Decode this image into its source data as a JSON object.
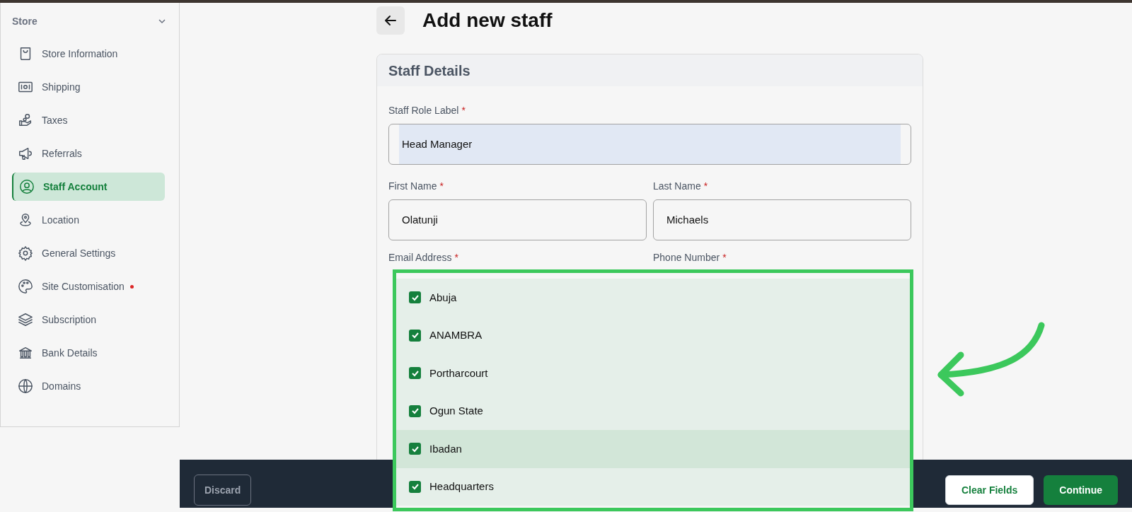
{
  "sidebar": {
    "section": "Store",
    "expanded": true,
    "items": [
      {
        "label": "Store Information",
        "selected": false,
        "notification": false
      },
      {
        "label": "Shipping",
        "selected": false,
        "notification": false
      },
      {
        "label": "Taxes",
        "selected": false,
        "notification": false
      },
      {
        "label": "Referrals",
        "selected": false,
        "notification": false
      },
      {
        "label": "Staff Account",
        "selected": true,
        "notification": false
      },
      {
        "label": "Location",
        "selected": false,
        "notification": false
      },
      {
        "label": "General Settings",
        "selected": false,
        "notification": false
      },
      {
        "label": "Site Customisation",
        "selected": false,
        "notification": true
      },
      {
        "label": "Subscription",
        "selected": false,
        "notification": false
      },
      {
        "label": "Bank Details",
        "selected": false,
        "notification": false
      },
      {
        "label": "Domains",
        "selected": false,
        "notification": false
      }
    ]
  },
  "page": {
    "title": "Add new staff"
  },
  "card": {
    "title": "Staff Details",
    "fields": [
      {
        "label": "Staff Role Label",
        "required_mark": "*",
        "value": "Head Manager",
        "highlighted": true
      },
      {
        "label": "First Name",
        "required_mark": "*",
        "value": "Olatunji",
        "highlighted": false
      },
      {
        "label": "Last Name",
        "required_mark": "*",
        "value": "Michaels",
        "highlighted": false
      },
      {
        "label": "Email Address",
        "required_mark": "*"
      },
      {
        "label": "Phone Number",
        "required_mark": "*"
      }
    ]
  },
  "location_dropdown": {
    "options": [
      {
        "label": "Abuja",
        "checked": true,
        "hovered": false
      },
      {
        "label": "ANAMBRA",
        "checked": true,
        "hovered": false
      },
      {
        "label": "Portharcourt",
        "checked": true,
        "hovered": false
      },
      {
        "label": "Ogun State",
        "checked": true,
        "hovered": false
      },
      {
        "label": "Ibadan",
        "checked": true,
        "hovered": true
      },
      {
        "label": "Headquarters",
        "checked": true,
        "hovered": false
      }
    ]
  },
  "footer": {
    "buttons": [
      {
        "label": "Discard",
        "kind": "outline"
      },
      {
        "label": "Clear Fields",
        "kind": "secondary"
      },
      {
        "label": "Continue",
        "kind": "primary"
      }
    ]
  }
}
